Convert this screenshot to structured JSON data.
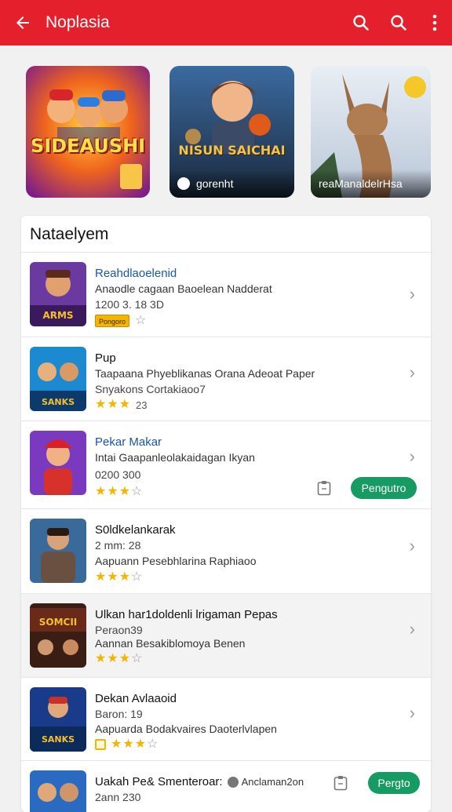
{
  "appbar": {
    "title": "Noplasia",
    "back_icon": "arrow-back-icon",
    "actions": [
      "search-icon",
      "search-icon",
      "more-vert-icon"
    ],
    "color": "#e3202b"
  },
  "banners": [
    {
      "art_title": "SIDEAUSHI",
      "caption": ""
    },
    {
      "art_title": "NISUN SAICHAI",
      "caption": "gorenht"
    },
    {
      "art_title": "",
      "caption": "reaManaldelrHsa"
    }
  ],
  "section": {
    "title": "Nataelyem",
    "items": [
      {
        "title": "Reahdlaoelenid",
        "line1": "Anaodle cagaan Baoelean Nadderat",
        "line2": "1200 3. 18 3D",
        "badge": "Pongoro",
        "stars": 0,
        "empty_stars": 1,
        "thumb_text": "ARMS",
        "title_blue": true
      },
      {
        "title": "Pup",
        "line1": "Taapaana Phyeblikanas Orana Adeoat Paper",
        "line2": "Snyakons Cortakiaoo7",
        "stars": 3,
        "empty_stars": 0,
        "rating": "23",
        "thumb_text": "SANKS"
      },
      {
        "title": "Pekar Makar",
        "line1": "Intai Gaapanleolakaidagan Ikyan",
        "line2": "0200 300",
        "stars": 3,
        "empty_stars": 1,
        "thumb_text": "",
        "button": "Pengutro",
        "title_blue": true
      },
      {
        "title": "S0ldkelankarak",
        "line1": "2 mm: 28",
        "line2": "Aapuann Pesebhlarina Raphiaoo",
        "stars": 3,
        "empty_stars": 1,
        "thumb_text": ""
      },
      {
        "title": "Ulkan har1doldenli lrigaman Pepas",
        "line1": "Peraon39",
        "line2": "Aannan Besakiblomoya Benen",
        "stars": 3,
        "empty_stars": 1,
        "thumb_text": "SOMCII",
        "highlight": true
      },
      {
        "title": "Dekan Avlaaoid",
        "line1": "Baron: 19",
        "line2": "Aapuarda Bodakvaires Daoterlvlapen",
        "badge_square": true,
        "stars": 3,
        "empty_stars": 1,
        "thumb_text": "SANKS"
      },
      {
        "title": "Uakah Pe& Smenteroar:",
        "line1_suffix": "Anclaman2on",
        "line2": "2ann 230",
        "button": "Pergto",
        "thumb_text": ""
      }
    ]
  },
  "colors": {
    "accent": "#e3202b",
    "green": "#169b62",
    "star": "#f4b400",
    "link": "#1a56a6"
  }
}
